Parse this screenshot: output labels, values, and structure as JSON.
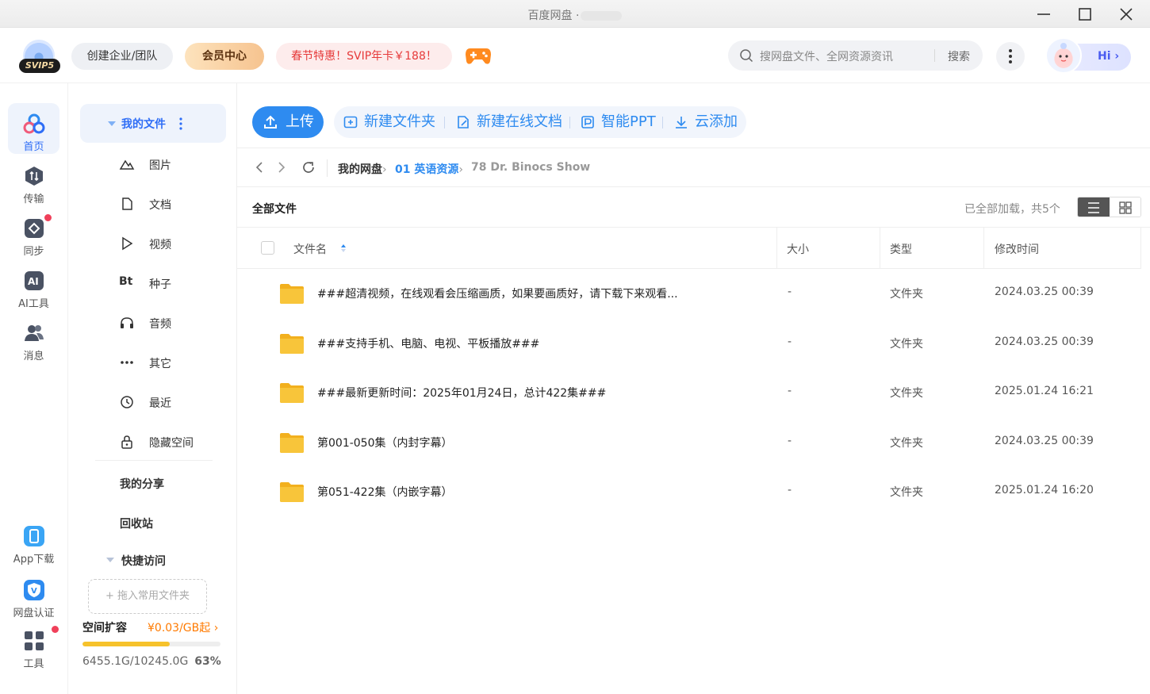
{
  "window": {
    "title": "百度网盘 ·"
  },
  "header": {
    "avatar_badge": "SVIP5",
    "team_button": "创建企业/团队",
    "vip_button": "会员中心",
    "promo_button": "春节特惠！SVIP年卡￥188！",
    "search": {
      "placeholder": "搜网盘文件、全网资源资讯",
      "button": "搜索"
    },
    "assistant_label": "Hi"
  },
  "rail": {
    "items": [
      {
        "label": "首页",
        "icon": "home-icon"
      },
      {
        "label": "传输",
        "icon": "transfer-icon"
      },
      {
        "label": "同步",
        "icon": "sync-icon"
      },
      {
        "label": "AI工具",
        "icon": "ai-tools-icon"
      },
      {
        "label": "消息",
        "icon": "message-icon"
      }
    ],
    "bottom": [
      {
        "label": "App下载",
        "icon": "app-download-icon"
      },
      {
        "label": "网盘认证",
        "icon": "verify-icon"
      },
      {
        "label": "工具",
        "icon": "tools-icon"
      }
    ]
  },
  "sidebar": {
    "my_files": "我的文件",
    "categories": [
      {
        "label": "图片",
        "icon": "image-icon"
      },
      {
        "label": "文档",
        "icon": "document-icon"
      },
      {
        "label": "视频",
        "icon": "video-icon"
      },
      {
        "label": "种子",
        "icon": "torrent-icon"
      },
      {
        "label": "音频",
        "icon": "audio-icon"
      },
      {
        "label": "其它",
        "icon": "other-icon"
      },
      {
        "label": "最近",
        "icon": "recent-icon"
      },
      {
        "label": "隐藏空间",
        "icon": "lock-icon"
      }
    ],
    "torrent_glyph": "Bt",
    "my_share": "我的分享",
    "recycle": "回收站",
    "quick_access": "快捷访问",
    "dropzone": "+ 拖入常用文件夹",
    "quota": {
      "title": "空间扩容",
      "price": "¥0.03/GB起 ›",
      "used_text": "6455.1G/10245.0G",
      "percent_text": "63%",
      "fraction": 0.63
    }
  },
  "toolbar": {
    "upload": "上传",
    "new_folder": "新建文件夹",
    "new_doc": "新建在线文档",
    "smart_ppt": "智能PPT",
    "cloud_add": "云添加"
  },
  "breadcrumb": {
    "root": "我的网盘",
    "level1": "01 英语资源",
    "current": "78 Dr. Binocs Show",
    "sep": "›"
  },
  "list": {
    "title": "全部文件",
    "status": "已全部加载，共5个",
    "columns": {
      "name": "文件名",
      "size": "大小",
      "type": "类型",
      "modified": "修改时间"
    },
    "rows": [
      {
        "name": "###超清视频，在线观看会压缩画质，如果要画质好，请下载下来观看...",
        "size": "-",
        "type": "文件夹",
        "modified": "2024.03.25 00:39"
      },
      {
        "name": "###支持手机、电脑、电视、平板播放###",
        "size": "-",
        "type": "文件夹",
        "modified": "2024.03.25 00:39"
      },
      {
        "name": "###最新更新时间：2025年01月24日，总计422集###",
        "size": "-",
        "type": "文件夹",
        "modified": "2025.01.24 16:21"
      },
      {
        "name": "第001-050集（内封字幕）",
        "size": "-",
        "type": "文件夹",
        "modified": "2024.03.25 00:39"
      },
      {
        "name": "第051-422集（内嵌字幕）",
        "size": "-",
        "type": "文件夹",
        "modified": "2025.01.24 16:20"
      }
    ]
  },
  "colors": {
    "accent": "#2e8bf0",
    "active_blue": "#2e6df6",
    "quota_fill": "#f6c22b",
    "price_orange": "#ff7a00",
    "folder_yellow": "#f8c53a"
  }
}
